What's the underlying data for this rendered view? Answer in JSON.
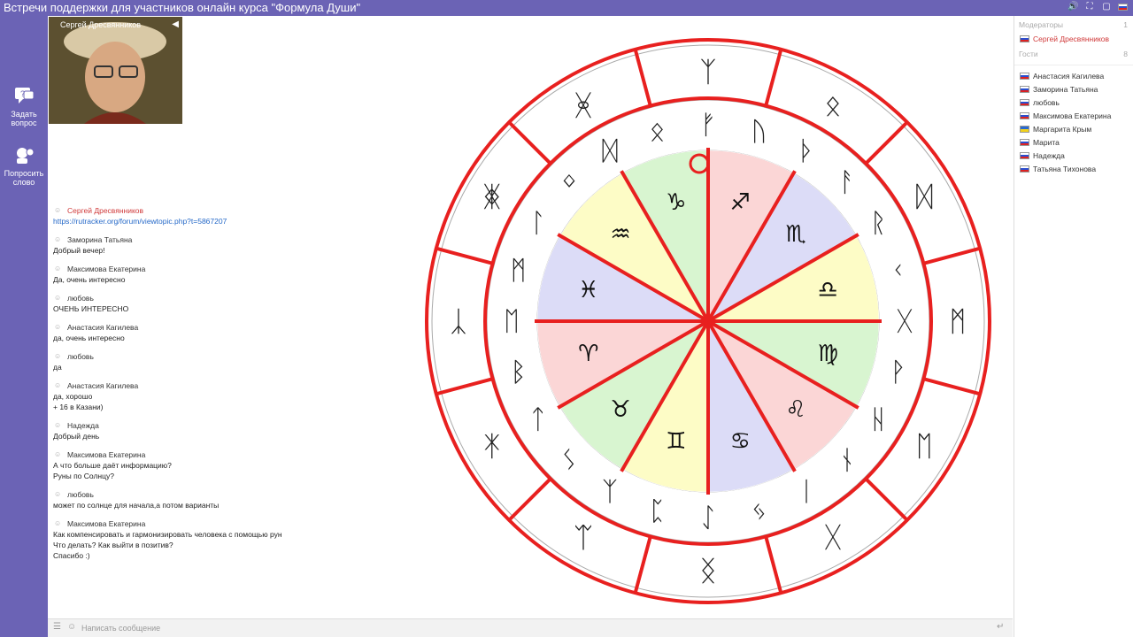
{
  "title": "Встречи поддержки для участников онлайн курса \"Формула Души\"",
  "topbar_icons": [
    "volume-icon",
    "fullscreen-icon",
    "popout-icon",
    "language-flag-ru"
  ],
  "leftbar": [
    {
      "label": "Задать вопрос",
      "icon": "question-bubble-icon"
    },
    {
      "label": "Попросить слово",
      "icon": "speaker-request-icon"
    }
  ],
  "video": {
    "name": "Сергей Дресвянников",
    "icon": "speaker-muted-icon"
  },
  "messages": [
    {
      "author": "Сергей Дресвянников",
      "moderator": true,
      "lines": [
        "https://rutracker.org/forum/viewtopic.php?t=5867207"
      ],
      "link": true
    },
    {
      "author": "Заморина Татьяна",
      "lines": [
        "Добрый вечер!"
      ]
    },
    {
      "author": "Максимова Екатерина",
      "lines": [
        "Да, очень интересно"
      ]
    },
    {
      "author": "любовь",
      "lines": [
        "ОЧЕНЬ ИНТЕРЕСНО"
      ]
    },
    {
      "author": "Анастасия Кагилева",
      "lines": [
        "да, очень интересно"
      ]
    },
    {
      "author": "любовь",
      "lines": [
        "да"
      ]
    },
    {
      "author": "Анастасия Кагилева",
      "lines": [
        "да, хорошо",
        "+ 16 в Казани)"
      ]
    },
    {
      "author": "Надежда",
      "lines": [
        "Добрый день"
      ]
    },
    {
      "author": "Максимова Екатерина",
      "lines": [
        "А что больше даёт информацию?",
        "Руны по Солнцу?"
      ]
    },
    {
      "author": "любовь",
      "lines": [
        "может по солнце для начала,а потом варианты"
      ]
    },
    {
      "author": "Максимова Екатерина",
      "lines": [
        "Как компенсировать и гармонизировать человека с помощью рун",
        "Что делать? Как выйти в позитив?",
        "Спасибо :)"
      ]
    }
  ],
  "input": {
    "placeholder": "Написать сообщение"
  },
  "wheel": {
    "signs": [
      "♈",
      "♉",
      "♊",
      "♋",
      "♌",
      "♍",
      "♎",
      "♏",
      "♐",
      "♑",
      "♒",
      "♓"
    ],
    "sign_colors": [
      "#fbd6d6",
      "#d8f5d0",
      "#fdfcc6",
      "#dcdcf7"
    ],
    "inner_runes": [
      "ᚠ",
      "ᚢ",
      "ᚦ",
      "ᚨ",
      "ᚱ",
      "ᚲ",
      "ᚷ",
      "ᚹ",
      "ᚺ",
      "ᚾ",
      "ᛁ",
      "ᛃ",
      "ᛇ",
      "ᛈ",
      "ᛉ",
      "ᛊ",
      "ᛏ",
      "ᛒ",
      "ᛖ",
      "ᛗ",
      "ᛚ",
      "ᛜ",
      "ᛞ",
      "ᛟ"
    ],
    "outer_runes": [
      "ᛉ",
      "ᛟ",
      "ᛞ",
      "ᛗ",
      "ᛖ",
      "ᚷ",
      "ᛝ",
      "ᛠ",
      "ᛡ",
      "ᛣ",
      "ᛤ",
      "ᚸ"
    ],
    "annotation_color": "#e8201f"
  },
  "moderators": {
    "label": "Модераторы",
    "count": "1",
    "users": [
      "Сергей Дресвянников"
    ]
  },
  "guests": {
    "label": "Гости",
    "count": "8",
    "users": [
      {
        "name": "Анастасия Кагилева",
        "flag": "ru"
      },
      {
        "name": "Заморина Татьяна",
        "flag": "ru"
      },
      {
        "name": "любовь",
        "flag": "ru"
      },
      {
        "name": "Максимова Екатерина",
        "flag": "ru"
      },
      {
        "name": "Маргарита Крым",
        "flag": "ua"
      },
      {
        "name": "Марита",
        "flag": "ru"
      },
      {
        "name": "Надежда",
        "flag": "ru"
      },
      {
        "name": "Татьяна Тихонова",
        "flag": "ru"
      }
    ]
  }
}
